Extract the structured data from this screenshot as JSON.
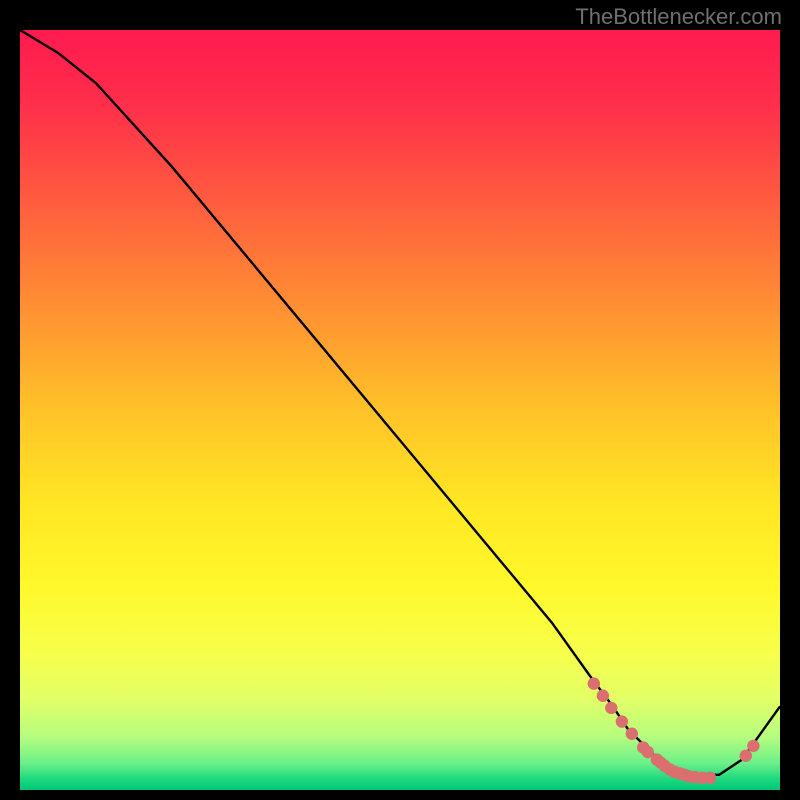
{
  "watermark": "TheBottlenecker.com",
  "colors": {
    "bg": "#000000",
    "curve": "#000000",
    "marker_fill": "#db6e6f",
    "gradient_stops": [
      {
        "offset": 0.0,
        "color": "#ff1a4f"
      },
      {
        "offset": 0.1,
        "color": "#ff2f4a"
      },
      {
        "offset": 0.22,
        "color": "#ff5a3f"
      },
      {
        "offset": 0.35,
        "color": "#ff8a34"
      },
      {
        "offset": 0.5,
        "color": "#ffc228"
      },
      {
        "offset": 0.62,
        "color": "#ffe623"
      },
      {
        "offset": 0.73,
        "color": "#fff82a"
      },
      {
        "offset": 0.82,
        "color": "#f7ff4a"
      },
      {
        "offset": 0.88,
        "color": "#e2ff66"
      },
      {
        "offset": 0.93,
        "color": "#b6fd7e"
      },
      {
        "offset": 0.965,
        "color": "#6af088"
      },
      {
        "offset": 0.985,
        "color": "#1fd97f"
      },
      {
        "offset": 1.0,
        "color": "#00c779"
      }
    ]
  },
  "chart_data": {
    "type": "line",
    "title": "",
    "xlabel": "",
    "ylabel": "",
    "xlim": [
      0,
      100
    ],
    "ylim": [
      0,
      100
    ],
    "series": [
      {
        "name": "bottleneck-curve",
        "x": [
          0,
          5,
          10,
          20,
          30,
          40,
          50,
          60,
          70,
          75,
          78,
          80,
          83,
          85,
          88,
          90,
          92,
          95,
          100
        ],
        "y": [
          100,
          97,
          93,
          82,
          70,
          58,
          46,
          34,
          22,
          15,
          11,
          8,
          5,
          3,
          2,
          2,
          2,
          4,
          11
        ]
      }
    ],
    "markers": {
      "name": "highlight-points",
      "x": [
        75.5,
        76.7,
        77.8,
        79.2,
        80.5,
        82.0,
        82.6,
        83.8,
        84.3,
        84.8,
        85.5,
        86.1,
        86.8,
        87.4,
        88.0,
        88.8,
        89.8,
        90.8,
        95.5,
        96.5
      ],
      "y": [
        14.0,
        12.4,
        10.8,
        9.0,
        7.4,
        5.6,
        5.0,
        4.0,
        3.6,
        3.2,
        2.7,
        2.4,
        2.2,
        2.0,
        1.8,
        1.7,
        1.6,
        1.6,
        4.5,
        5.8
      ]
    }
  }
}
